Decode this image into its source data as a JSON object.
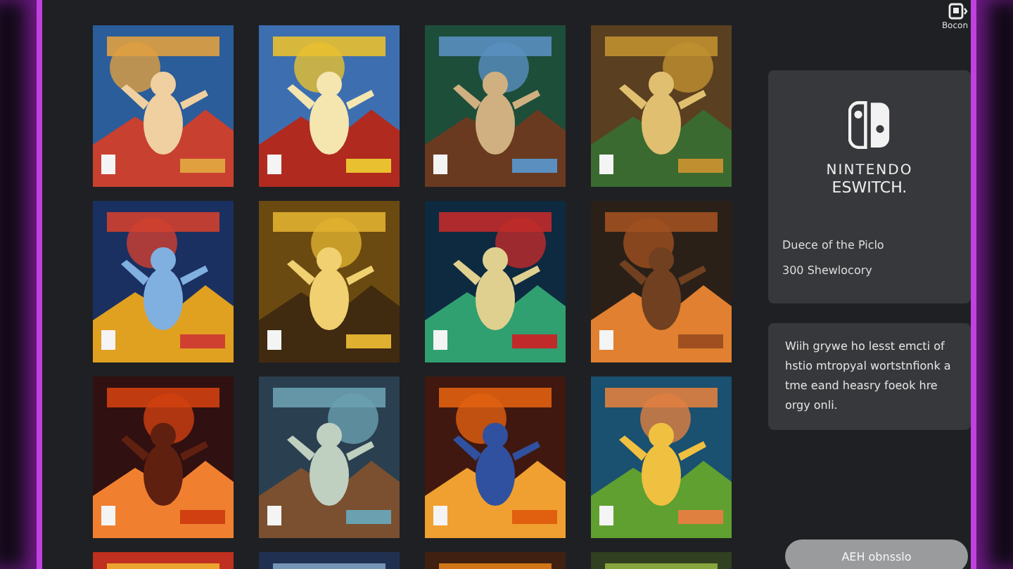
{
  "top_bar": {
    "account_label": "Bocon"
  },
  "brand_card": {
    "line_1": "NINTENDO",
    "line_2": "ESWITCH.",
    "title": "Duece of the Piclo",
    "subtitle": "300 Shewlocory"
  },
  "info_card": {
    "text": "Wiih grywe ho lesst emcti of hstio mtropyal wortstnfionk a tme eand heasry foeok hre orgy onli."
  },
  "action_button": {
    "label": "AEH obnsslo"
  }
}
